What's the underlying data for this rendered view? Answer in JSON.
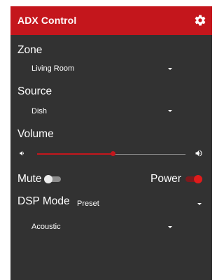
{
  "appbar": {
    "title": "ADX Control",
    "settings_icon": "gear-icon"
  },
  "zone": {
    "label": "Zone",
    "selected": "Living Room"
  },
  "source": {
    "label": "Source",
    "selected": "Dish"
  },
  "volume": {
    "label": "Volume",
    "level_fraction": 0.51
  },
  "mute": {
    "label": "Mute",
    "on": false
  },
  "power": {
    "label": "Power",
    "on": true
  },
  "dsp": {
    "label": "DSP Mode",
    "mode_selected": "Preset",
    "preset_selected": "Acoustic"
  },
  "colors": {
    "accent": "#c4161c",
    "background": "#323232",
    "text": "#ffffff"
  }
}
